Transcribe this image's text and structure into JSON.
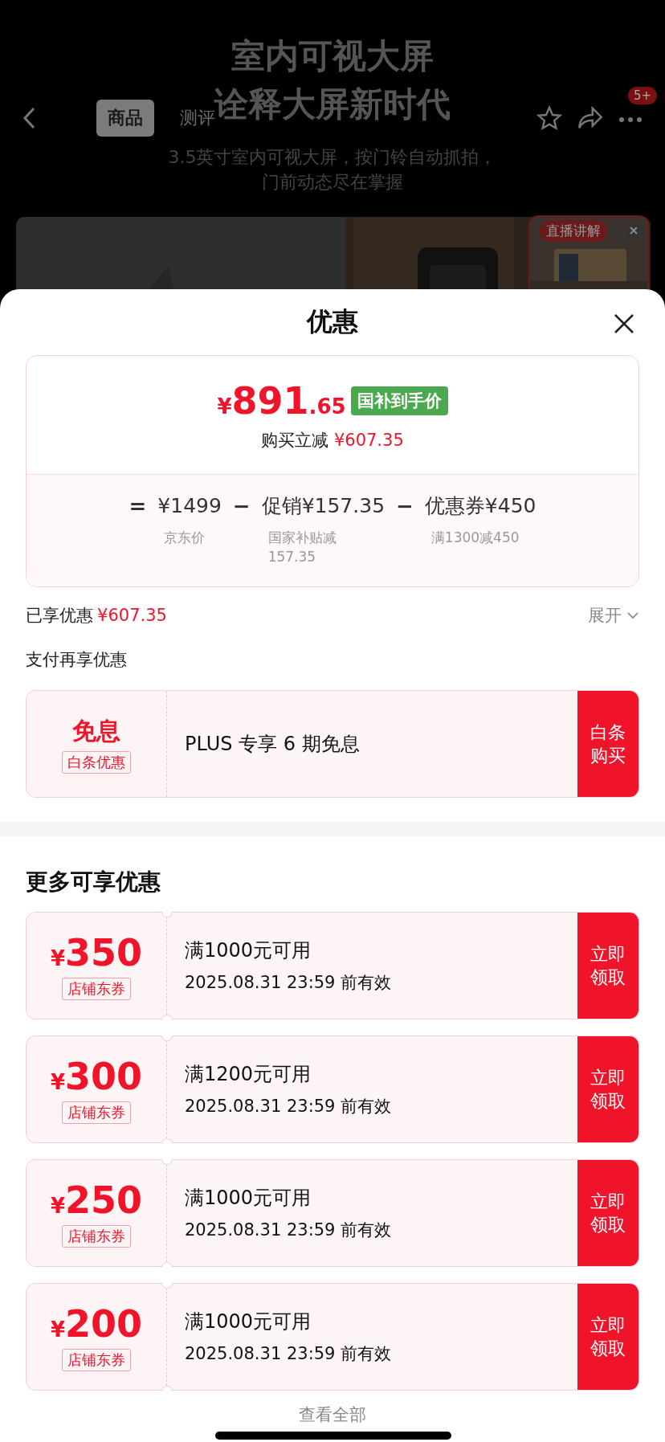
{
  "background": {
    "headline": [
      "室内可视大屏",
      "诠释大屏新时代"
    ],
    "tabs": [
      {
        "label": "商品",
        "selected": true
      },
      {
        "label": "测评",
        "selected": false
      }
    ],
    "badge": "5+",
    "subtitle": [
      "3.5英寸室内可视大屏，按门铃自动抓拍，",
      "门前动态尽在掌握"
    ],
    "live": {
      "label": "直播讲解"
    }
  },
  "sheet": {
    "title": "优惠",
    "price": {
      "currency": "¥",
      "integer": "891",
      "decimal": ".65",
      "tag": "国补到手价",
      "reduction_label": "购买立减",
      "reduction": "¥607.35"
    },
    "breakdown": [
      {
        "kind": "operator",
        "text": "="
      },
      {
        "kind": "term",
        "amount": "¥1499",
        "note": [
          "京东价"
        ]
      },
      {
        "kind": "operator",
        "text": "−"
      },
      {
        "kind": "term",
        "amount": "促销¥157.35",
        "note": [
          "国家补贴减",
          "157.35"
        ]
      },
      {
        "kind": "operator",
        "text": "−"
      },
      {
        "kind": "term",
        "amount": "优惠券¥450",
        "note": [
          "满1300减450"
        ]
      }
    ],
    "enjoyed": {
      "label": "已享优惠",
      "amount": "¥607.35",
      "toggle": "展开",
      "expanded": false
    },
    "pay": {
      "title": "支付再享优惠",
      "offer": {
        "headline": "免息",
        "tag": "白条优惠",
        "text": "PLUS 专享 6 期免息",
        "action": "白条购买"
      }
    },
    "more": {
      "title": "更多可享优惠",
      "coupons": [
        {
          "currency": "¥",
          "amount": "350",
          "tag": "店铺东券",
          "condition": "满1000元可用",
          "validity": "2025.08.31 23:59 前有效",
          "action": "立即领取"
        },
        {
          "currency": "¥",
          "amount": "300",
          "tag": "店铺东券",
          "condition": "满1200元可用",
          "validity": "2025.08.31 23:59 前有效",
          "action": "立即领取"
        },
        {
          "currency": "¥",
          "amount": "250",
          "tag": "店铺东券",
          "condition": "满1000元可用",
          "validity": "2025.08.31 23:59 前有效",
          "action": "立即领取"
        },
        {
          "currency": "¥",
          "amount": "200",
          "tag": "店铺东券",
          "condition": "满1000元可用",
          "validity": "2025.08.31 23:59 前有效",
          "action": "立即领取"
        }
      ],
      "view_all": "查看全部"
    }
  }
}
